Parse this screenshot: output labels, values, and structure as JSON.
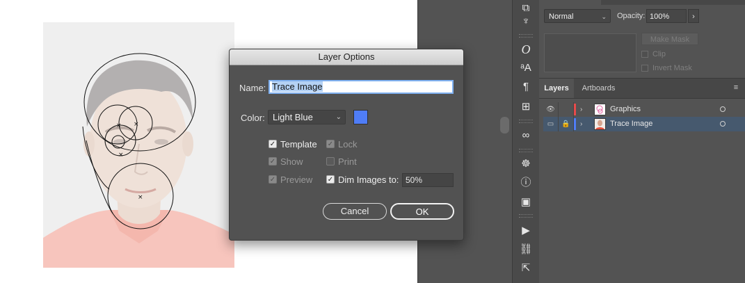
{
  "dialog": {
    "title": "Layer Options",
    "name_label": "Name:",
    "name_value": "Trace Image",
    "color_label": "Color:",
    "color_value": "Light Blue",
    "color_swatch": "#4f7df7",
    "options": {
      "template": "Template",
      "lock": "Lock",
      "show": "Show",
      "print": "Print",
      "preview": "Preview",
      "dim_images": "Dim Images to:"
    },
    "checks": {
      "template": true,
      "lock": true,
      "show": true,
      "print": false,
      "preview": true,
      "dim_images": true
    },
    "dim_value": "50%",
    "cancel_label": "Cancel",
    "ok_label": "OK"
  },
  "transparency": {
    "blend_mode": "Normal",
    "opacity_label": "Opacity:",
    "opacity_value": "100%",
    "make_mask_label": "Make Mask",
    "clip_label": "Clip",
    "invert_mask_label": "Invert Mask"
  },
  "layers_panel": {
    "tabs": [
      "Layers",
      "Artboards"
    ],
    "rows": [
      {
        "name": "Graphics",
        "color": "#e84a4a"
      },
      {
        "name": "Trace Image",
        "color": "#4f7df7"
      }
    ]
  },
  "icons": {
    "toolstrip": [
      "libraries-icon",
      "puppet-icon",
      "character-icon",
      "glyphs-icon",
      "paragraph-icon",
      "align-icon",
      "creative-cloud-icon",
      "navigator-icon",
      "info-icon",
      "document-info-icon",
      "actions-play-icon",
      "links-icon",
      "export-icon"
    ]
  },
  "colors": {
    "app_bg": "#535353",
    "selected_row": "#46596e",
    "accent_blue": "#4f7df7"
  }
}
